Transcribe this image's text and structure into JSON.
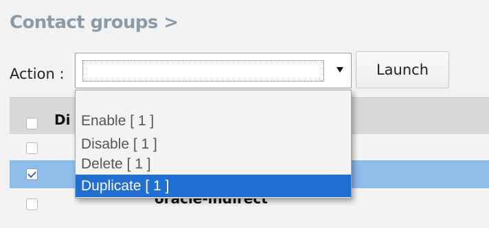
{
  "page_title": "Contact groups >",
  "action": {
    "label": "Action :",
    "selected_value": "",
    "launch_label": "Launch",
    "options": [
      {
        "label": "Enable [ 1 ]",
        "highlighted": false
      },
      {
        "label": "Disable [ 1 ]",
        "highlighted": false
      },
      {
        "label": "Delete [ 1 ]",
        "highlighted": false
      },
      {
        "label": "Duplicate [ 1 ]",
        "highlighted": true
      }
    ]
  },
  "table": {
    "header_label": "Di",
    "rows": [
      {
        "name": "",
        "checked": false,
        "selected": false
      },
      {
        "name": "",
        "checked": true,
        "selected": true
      },
      {
        "name": "oracle-indirect",
        "checked": false,
        "selected": false
      }
    ]
  },
  "colors": {
    "title": "#8c9aa5",
    "selected_row": "#8fbdea",
    "highlight": "#1f6fd2",
    "header_row": "#d8d8d8"
  }
}
